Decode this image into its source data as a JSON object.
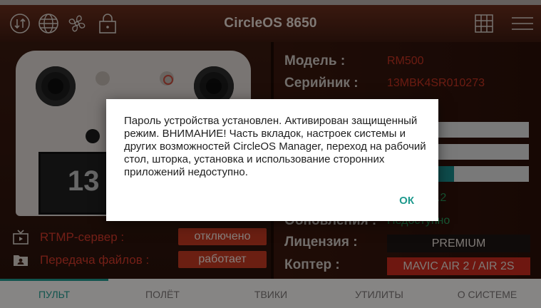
{
  "header": {
    "title": "CircleOS 8650",
    "icons": [
      "sync-icon",
      "globe-icon",
      "fan-icon",
      "lock-icon",
      "grid-icon",
      "menu-icon"
    ]
  },
  "controller": {
    "screen_text": "13"
  },
  "status": [
    {
      "icon": "tv-icon",
      "label": "RTMP-сервер :",
      "value": "отключено"
    },
    {
      "icon": "folder-icon",
      "label": "Передача файлов :",
      "value": "работает"
    }
  ],
  "info": {
    "model_label": "Модель :",
    "model_value": "RM500",
    "serial_label": "Серийник :",
    "serial_value": "13MBK4SR010273",
    "version_fragment": "0.2",
    "updates_label": "Обновления :",
    "updates_value": "Недоступно",
    "license_label": "Лицензия :",
    "license_value": "PREMIUM",
    "copter_label": "Коптер :",
    "copter_value": "MAVIC AIR 2 / AIR 2S",
    "bars": [
      0.0,
      0.0,
      0.47
    ]
  },
  "tabs": [
    {
      "label": "ПУЛЬТ",
      "active": true
    },
    {
      "label": "ПОЛЁТ",
      "active": false
    },
    {
      "label": "ТВИКИ",
      "active": false
    },
    {
      "label": "УТИЛИТЫ",
      "active": false
    },
    {
      "label": "О СИСТЕМЕ",
      "active": false
    }
  ],
  "dialog": {
    "message": "Пароль устройства установлен. Активирован защищенный режим. ВНИМАНИЕ! Часть вкладок, настроек системы и других возможностей CircleOS Manager, переход на рабочий стол, шторка, установка и использование сторонних приложений недоступно.",
    "ok_label": "ОК"
  },
  "colors": {
    "accent": "#1f9a8e",
    "danger": "#c43322",
    "header": "#5a2616"
  }
}
